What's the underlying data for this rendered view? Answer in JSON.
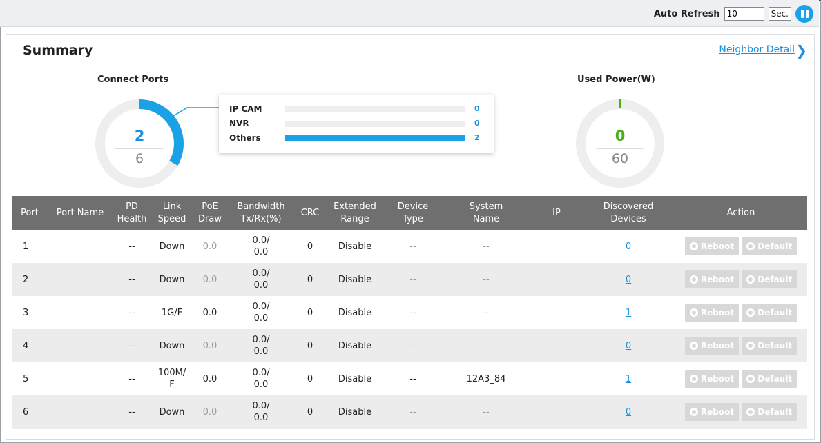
{
  "topbar": {
    "auto_refresh_label": "Auto Refresh",
    "refresh_value": "10",
    "unit": "Sec."
  },
  "summary": {
    "title": "Summary",
    "neighbor_link": "Neighbor Detail"
  },
  "connect_ports": {
    "label": "Connect Ports",
    "connected": "2",
    "total": "6",
    "fraction": 0.333
  },
  "legend": [
    {
      "name": "IP CAM",
      "value": "0",
      "fraction": 0
    },
    {
      "name": "NVR",
      "value": "0",
      "fraction": 0
    },
    {
      "name": "Others",
      "value": "2",
      "fraction": 1
    }
  ],
  "used_power": {
    "label": "Used Power(W)",
    "used": "0",
    "total": "60"
  },
  "table": {
    "headers": [
      "Port",
      "Port Name",
      "PD\nHealth",
      "Link\nSpeed",
      "PoE\nDraw",
      "Bandwidth\nTx/Rx(%)",
      "CRC",
      "Extended\nRange",
      "Device\nType",
      "System\nName",
      "IP",
      "Discovered\nDevices",
      "Action"
    ],
    "reboot_label": "Reboot",
    "default_label": "Default",
    "rows": [
      {
        "port": "1",
        "port_name": "",
        "pd_health": "--",
        "link_speed": "Down",
        "poe_draw": "0.0",
        "bandwidth": "0.0/\n0.0",
        "crc": "0",
        "extended_range": "Disable",
        "device_type": "--",
        "system_name": "--",
        "ip": "",
        "discovered": "0"
      },
      {
        "port": "2",
        "port_name": "",
        "pd_health": "--",
        "link_speed": "Down",
        "poe_draw": "0.0",
        "bandwidth": "0.0/\n0.0",
        "crc": "0",
        "extended_range": "Disable",
        "device_type": "--",
        "system_name": "--",
        "ip": "",
        "discovered": "0"
      },
      {
        "port": "3",
        "port_name": "",
        "pd_health": "--",
        "link_speed": "1G/F",
        "poe_draw": "0.0",
        "bandwidth": "0.0/\n0.0",
        "crc": "0",
        "extended_range": "Disable",
        "device_type": "--",
        "system_name": "--",
        "ip": "",
        "discovered": "1"
      },
      {
        "port": "4",
        "port_name": "",
        "pd_health": "--",
        "link_speed": "Down",
        "poe_draw": "0.0",
        "bandwidth": "0.0/\n0.0",
        "crc": "0",
        "extended_range": "Disable",
        "device_type": "--",
        "system_name": "--",
        "ip": "",
        "discovered": "0"
      },
      {
        "port": "5",
        "port_name": "",
        "pd_health": "--",
        "link_speed": "100M/\nF",
        "poe_draw": "0.0",
        "bandwidth": "0.0/\n0.0",
        "crc": "0",
        "extended_range": "Disable",
        "device_type": "--",
        "system_name": "12A3_84",
        "ip": "",
        "discovered": "1"
      },
      {
        "port": "6",
        "port_name": "",
        "pd_health": "--",
        "link_speed": "Down",
        "poe_draw": "0.0",
        "bandwidth": "0.0/\n0.0",
        "crc": "0",
        "extended_range": "Disable",
        "device_type": "--",
        "system_name": "--",
        "ip": "",
        "discovered": "0"
      }
    ]
  },
  "colors": {
    "accent": "#1aa1e6",
    "power": "#4caf1a",
    "header": "#6f6f6f"
  }
}
